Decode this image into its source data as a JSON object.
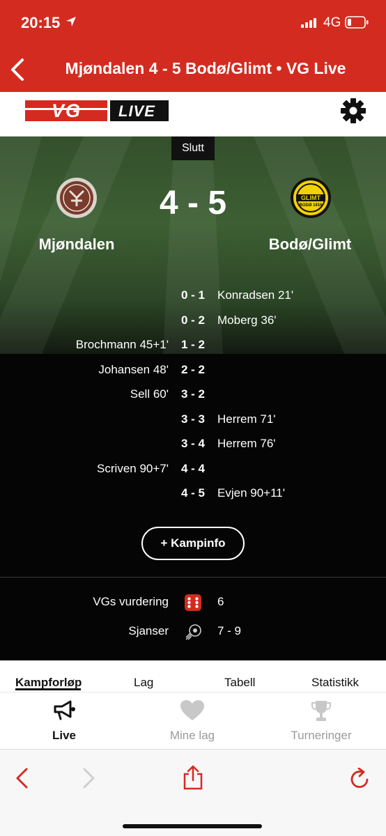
{
  "status_bar": {
    "time": "20:15",
    "network": "4G",
    "icons": [
      "location-arrow-icon",
      "signal-bars-icon",
      "battery-low-icon"
    ]
  },
  "nav": {
    "title": "Mjøndalen 4 - 5 Bodø/Glimt • VG Live",
    "back_icon": "chevron-left-icon"
  },
  "brand": {
    "logo_vg": "VG",
    "logo_live": "LIVE",
    "settings_icon": "gear-icon",
    "accent_color": "#d42b20"
  },
  "match": {
    "status": "Slutt",
    "score": "4 - 5",
    "home_team": "Mjøndalen",
    "away_team": "Bodø/Glimt",
    "home_crest_text": "MIF",
    "away_crest_text": "GLIMT",
    "away_crest_year": "BODØ 1916"
  },
  "goals": [
    {
      "home": "",
      "score": "0 - 1",
      "away": "Konradsen 21'"
    },
    {
      "home": "",
      "score": "0 - 2",
      "away": "Moberg 36'"
    },
    {
      "home": "Brochmann 45+1'",
      "score": "1 - 2",
      "away": ""
    },
    {
      "home": "Johansen 48'",
      "score": "2 - 2",
      "away": ""
    },
    {
      "home": "Sell 60'",
      "score": "3 - 2",
      "away": ""
    },
    {
      "home": "",
      "score": "3 - 3",
      "away": "Herrem 71'"
    },
    {
      "home": "",
      "score": "3 - 4",
      "away": "Herrem 76'"
    },
    {
      "home": "Scriven 90+7'",
      "score": "4 - 4",
      "away": ""
    },
    {
      "home": "",
      "score": "4 - 5",
      "away": "Evjen 90+11'"
    }
  ],
  "kampinfo_label": "+ Kampinfo",
  "stats": [
    {
      "label": "VGs vurdering",
      "icon": "dice-icon",
      "value": "6"
    },
    {
      "label": "Sjanser",
      "icon": "chances-icon",
      "value": "7 - 9"
    }
  ],
  "tabs": [
    {
      "label": "Kampforløp",
      "active": true
    },
    {
      "label": "Lag",
      "active": false
    },
    {
      "label": "Tabell",
      "active": false
    },
    {
      "label": "Statistikk",
      "active": false
    }
  ],
  "bottom_nav": [
    {
      "label": "Live",
      "icon": "megaphone-icon",
      "active": true
    },
    {
      "label": "Mine lag",
      "icon": "heart-icon",
      "active": false
    },
    {
      "label": "Turneringer",
      "icon": "trophy-icon",
      "active": false
    }
  ],
  "browser": {
    "icons": [
      "back-arrow-icon",
      "forward-arrow-icon",
      "share-icon",
      "reload-icon"
    ]
  }
}
